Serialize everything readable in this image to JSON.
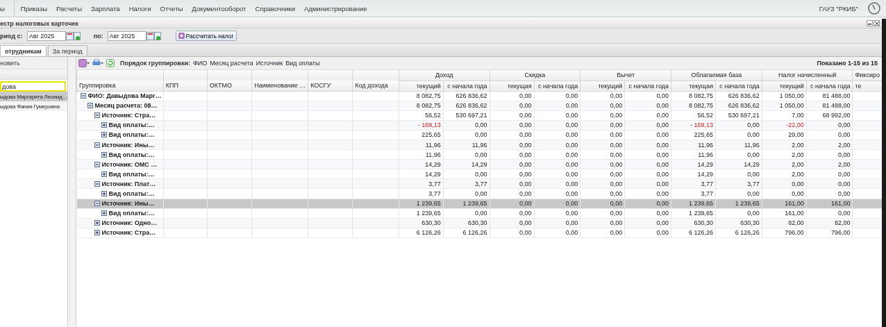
{
  "menu": [
    "ы",
    "Приказы",
    "Расчеты",
    "Зарплата",
    "Налоги",
    "Отчеты",
    "Документооборот",
    "Справочники",
    "Администрирование"
  ],
  "organization": "ГАУЗ \"РКИБ\"",
  "window": {
    "title": "естр налоговых карточек"
  },
  "period": {
    "from_label": "риод с:",
    "from_value": "Авг 2025",
    "to_label": "по:",
    "to_value": "Авг 2025",
    "calc_button": "Рассчитать налог"
  },
  "tabs": [
    {
      "label": "отрудникам",
      "selected": true
    },
    {
      "label": "За период",
      "selected": false
    }
  ],
  "left_panel": {
    "refresh_button": "новить",
    "search_value": "дова",
    "employees": [
      {
        "name": "ыдова Маргарита Леонид…",
        "selected": true
      },
      {
        "name": "ыдова Фания Гумеровна",
        "selected": false
      }
    ]
  },
  "grid_toolbar": {
    "grouping_label": "Порядок группировки:",
    "grouping_links": [
      "ФИО",
      "Месяц расчета",
      "Источник",
      "Вид оплаты"
    ],
    "paging": "Показано 1-15 из 15"
  },
  "columns": [
    "Группировка",
    "КПП",
    "ОКТМО",
    "Наименование …",
    "КОСГУ",
    "Код дохода"
  ],
  "column_groups": [
    {
      "title": "Доход",
      "sub": [
        "текущий",
        "с начала года"
      ]
    },
    {
      "title": "Скидка",
      "sub": [
        "текущая",
        "с начала года"
      ]
    },
    {
      "title": "Вычет",
      "sub": [
        "текущий",
        "с начала года"
      ]
    },
    {
      "title": "Облагаемая база",
      "sub": [
        "текущая",
        "с начала года"
      ]
    },
    {
      "title": "Налог начисленный",
      "sub": [
        "текущий",
        "с начала года"
      ]
    },
    {
      "title": "Фиксиро",
      "sub": [
        "те"
      ]
    }
  ],
  "tree": [
    {
      "label": "ФИО: Давыдова Марг…",
      "expanded": true,
      "selected": false,
      "cells": [
        "8 082,75",
        "626 836,62",
        "0,00",
        "0,00",
        "0,00",
        "0,00",
        "8 082,75",
        "626 836,62",
        "1 050,00",
        "81 488,00"
      ],
      "children": [
        {
          "label": "Месяц расчета: 08…",
          "expanded": true,
          "selected": false,
          "cells": [
            "8 082,75",
            "626 836,62",
            "0,00",
            "0,00",
            "0,00",
            "0,00",
            "8 082,75",
            "626 836,62",
            "1 050,00",
            "81 488,00"
          ],
          "children": [
            {
              "label": "Источник: Стра…",
              "expanded": true,
              "selected": false,
              "cells": [
                "56,52",
                "530 697,21",
                "0,00",
                "0,00",
                "0,00",
                "0,00",
                "56,52",
                "530 697,21",
                "7,00",
                "68 992,00"
              ],
              "children": [
                {
                  "label": "Вид оплаты:…",
                  "expanded": false,
                  "selected": false,
                  "cells": [
                    {
                      "text": "- 169,13",
                      "negative": true
                    },
                    "0,00",
                    "0,00",
                    "0,00",
                    "0,00",
                    "0,00",
                    {
                      "text": "- 169,13",
                      "negative": true
                    },
                    "0,00",
                    {
                      "text": "-22,00",
                      "negative": true
                    },
                    "0,00"
                  ]
                },
                {
                  "label": "Вид оплаты:…",
                  "expanded": false,
                  "selected": false,
                  "cells": [
                    "225,65",
                    "0,00",
                    "0,00",
                    "0,00",
                    "0,00",
                    "0,00",
                    "225,65",
                    "0,00",
                    "29,00",
                    "0,00"
                  ]
                }
              ]
            },
            {
              "label": "Источник: Ины…",
              "expanded": true,
              "selected": false,
              "cells": [
                "11,96",
                "11,96",
                "0,00",
                "0,00",
                "0,00",
                "0,00",
                "11,96",
                "11,96",
                "2,00",
                "2,00"
              ],
              "children": [
                {
                  "label": "Вид оплаты:…",
                  "expanded": false,
                  "selected": false,
                  "cells": [
                    "11,96",
                    "0,00",
                    "0,00",
                    "0,00",
                    "0,00",
                    "0,00",
                    "11,96",
                    "0,00",
                    "2,00",
                    "0,00"
                  ]
                }
              ]
            },
            {
              "label": "Источник: ОМС …",
              "expanded": true,
              "selected": false,
              "cells": [
                "14,29",
                "14,29",
                "0,00",
                "0,00",
                "0,00",
                "0,00",
                "14,29",
                "14,29",
                "2,00",
                "2,00"
              ],
              "children": [
                {
                  "label": "Вид оплаты:…",
                  "expanded": false,
                  "selected": false,
                  "cells": [
                    "14,29",
                    "0,00",
                    "0,00",
                    "0,00",
                    "0,00",
                    "0,00",
                    "14,29",
                    "0,00",
                    "2,00",
                    "0,00"
                  ]
                }
              ]
            },
            {
              "label": "Источник: Плат…",
              "expanded": true,
              "selected": false,
              "cells": [
                "3,77",
                "3,77",
                "0,00",
                "0,00",
                "0,00",
                "0,00",
                "3,77",
                "3,77",
                "0,00",
                "0,00"
              ],
              "children": [
                {
                  "label": "Вид оплаты:…",
                  "expanded": false,
                  "selected": false,
                  "cells": [
                    "3,77",
                    "0,00",
                    "0,00",
                    "0,00",
                    "0,00",
                    "0,00",
                    "3,77",
                    "0,00",
                    "0,00",
                    "0,00"
                  ]
                }
              ]
            },
            {
              "label": "Источник: Ины…",
              "expanded": true,
              "selected": true,
              "cells": [
                "1 239,65",
                "1 239,65",
                "0,00",
                "0,00",
                "0,00",
                "0,00",
                "1 239,65",
                "1 239,65",
                "161,00",
                "161,00"
              ],
              "children": [
                {
                  "label": "Вид оплаты:…",
                  "expanded": false,
                  "selected": false,
                  "cells": [
                    "1 239,65",
                    "0,00",
                    "0,00",
                    "0,00",
                    "0,00",
                    "0,00",
                    "1 239,65",
                    "0,00",
                    "161,00",
                    "0,00"
                  ]
                }
              ]
            },
            {
              "label": "Источник: Одно…",
              "expanded": false,
              "selected": false,
              "cells": [
                "630,30",
                "630,30",
                "0,00",
                "0,00",
                "0,00",
                "0,00",
                "630,30",
                "630,30",
                "82,00",
                "82,00"
              ]
            },
            {
              "label": "Источник: Стра…",
              "expanded": false,
              "selected": false,
              "cells": [
                "6 126,26",
                "6 126,26",
                "0,00",
                "0,00",
                "0,00",
                "0,00",
                "6 126,26",
                "6 126,26",
                "796,00",
                "796,00"
              ]
            }
          ]
        }
      ]
    }
  ]
}
